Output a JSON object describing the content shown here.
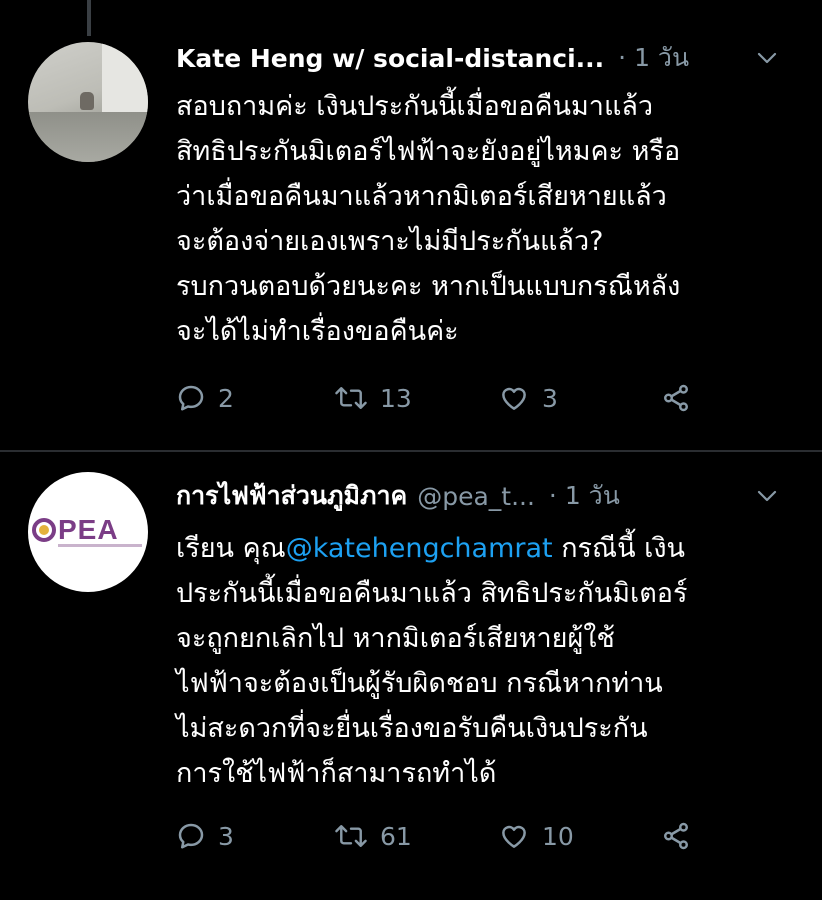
{
  "tweets": [
    {
      "display_name": "Kate Heng w/ social-distanci...",
      "handle": "",
      "meta": "· 1 วัน",
      "text_lines": [
        "สอบถามค่ะ เงินประกันนี้เมื่อขอคืนมาแล้ว",
        "สิทธิประกันมิเตอร์ไฟฟ้าจะยังอยู่ไหมคะ หรือ",
        "ว่าเมื่อขอคืนมาแล้วหากมิเตอร์เสียหายแล้ว",
        "จะต้องจ่ายเองเพราะไม่มีประกันแล้ว?",
        "รบกวนตอบด้วยนะคะ หากเป็นแบบกรณีหลัง",
        "จะได้ไม่ทำเรื่องขอคืนค่ะ"
      ],
      "replies": "2",
      "retweets": "13",
      "likes": "3"
    },
    {
      "display_name": "การไฟฟ้าส่วนภูมิภาค",
      "handle": "@pea_t...",
      "meta": "· 1 วัน",
      "avatar_text": "PEA",
      "text_prefix": "เรียน คุณ",
      "mention": "@katehengchamrat",
      "text_line1_suffix": " กรณีนี้ เงิน",
      "text_lines": [
        "ประกันนี้เมื่อขอคืนมาแล้ว สิทธิประกันมิเตอร์",
        "จะถูกยกเลิกไป หากมิเตอร์เสียหายผู้ใช้",
        "ไฟฟ้าจะต้องเป็นผู้รับผิดชอบ กรณีหากท่าน",
        "ไม่สะดวกที่จะยื่นเรื่องขอรับคืนเงินประกัน",
        "การใช้ไฟฟ้าก็สามารถทำได้"
      ],
      "replies": "3",
      "retweets": "61",
      "likes": "10"
    }
  ],
  "colors": {
    "background": "#000000",
    "text": "#ffffff",
    "muted": "#8899a6",
    "mention": "#1da1f2",
    "pea_purple": "#7b3d86"
  },
  "icons": [
    "reply-icon",
    "retweet-icon",
    "like-icon",
    "share-icon",
    "chevron-down-icon"
  ]
}
